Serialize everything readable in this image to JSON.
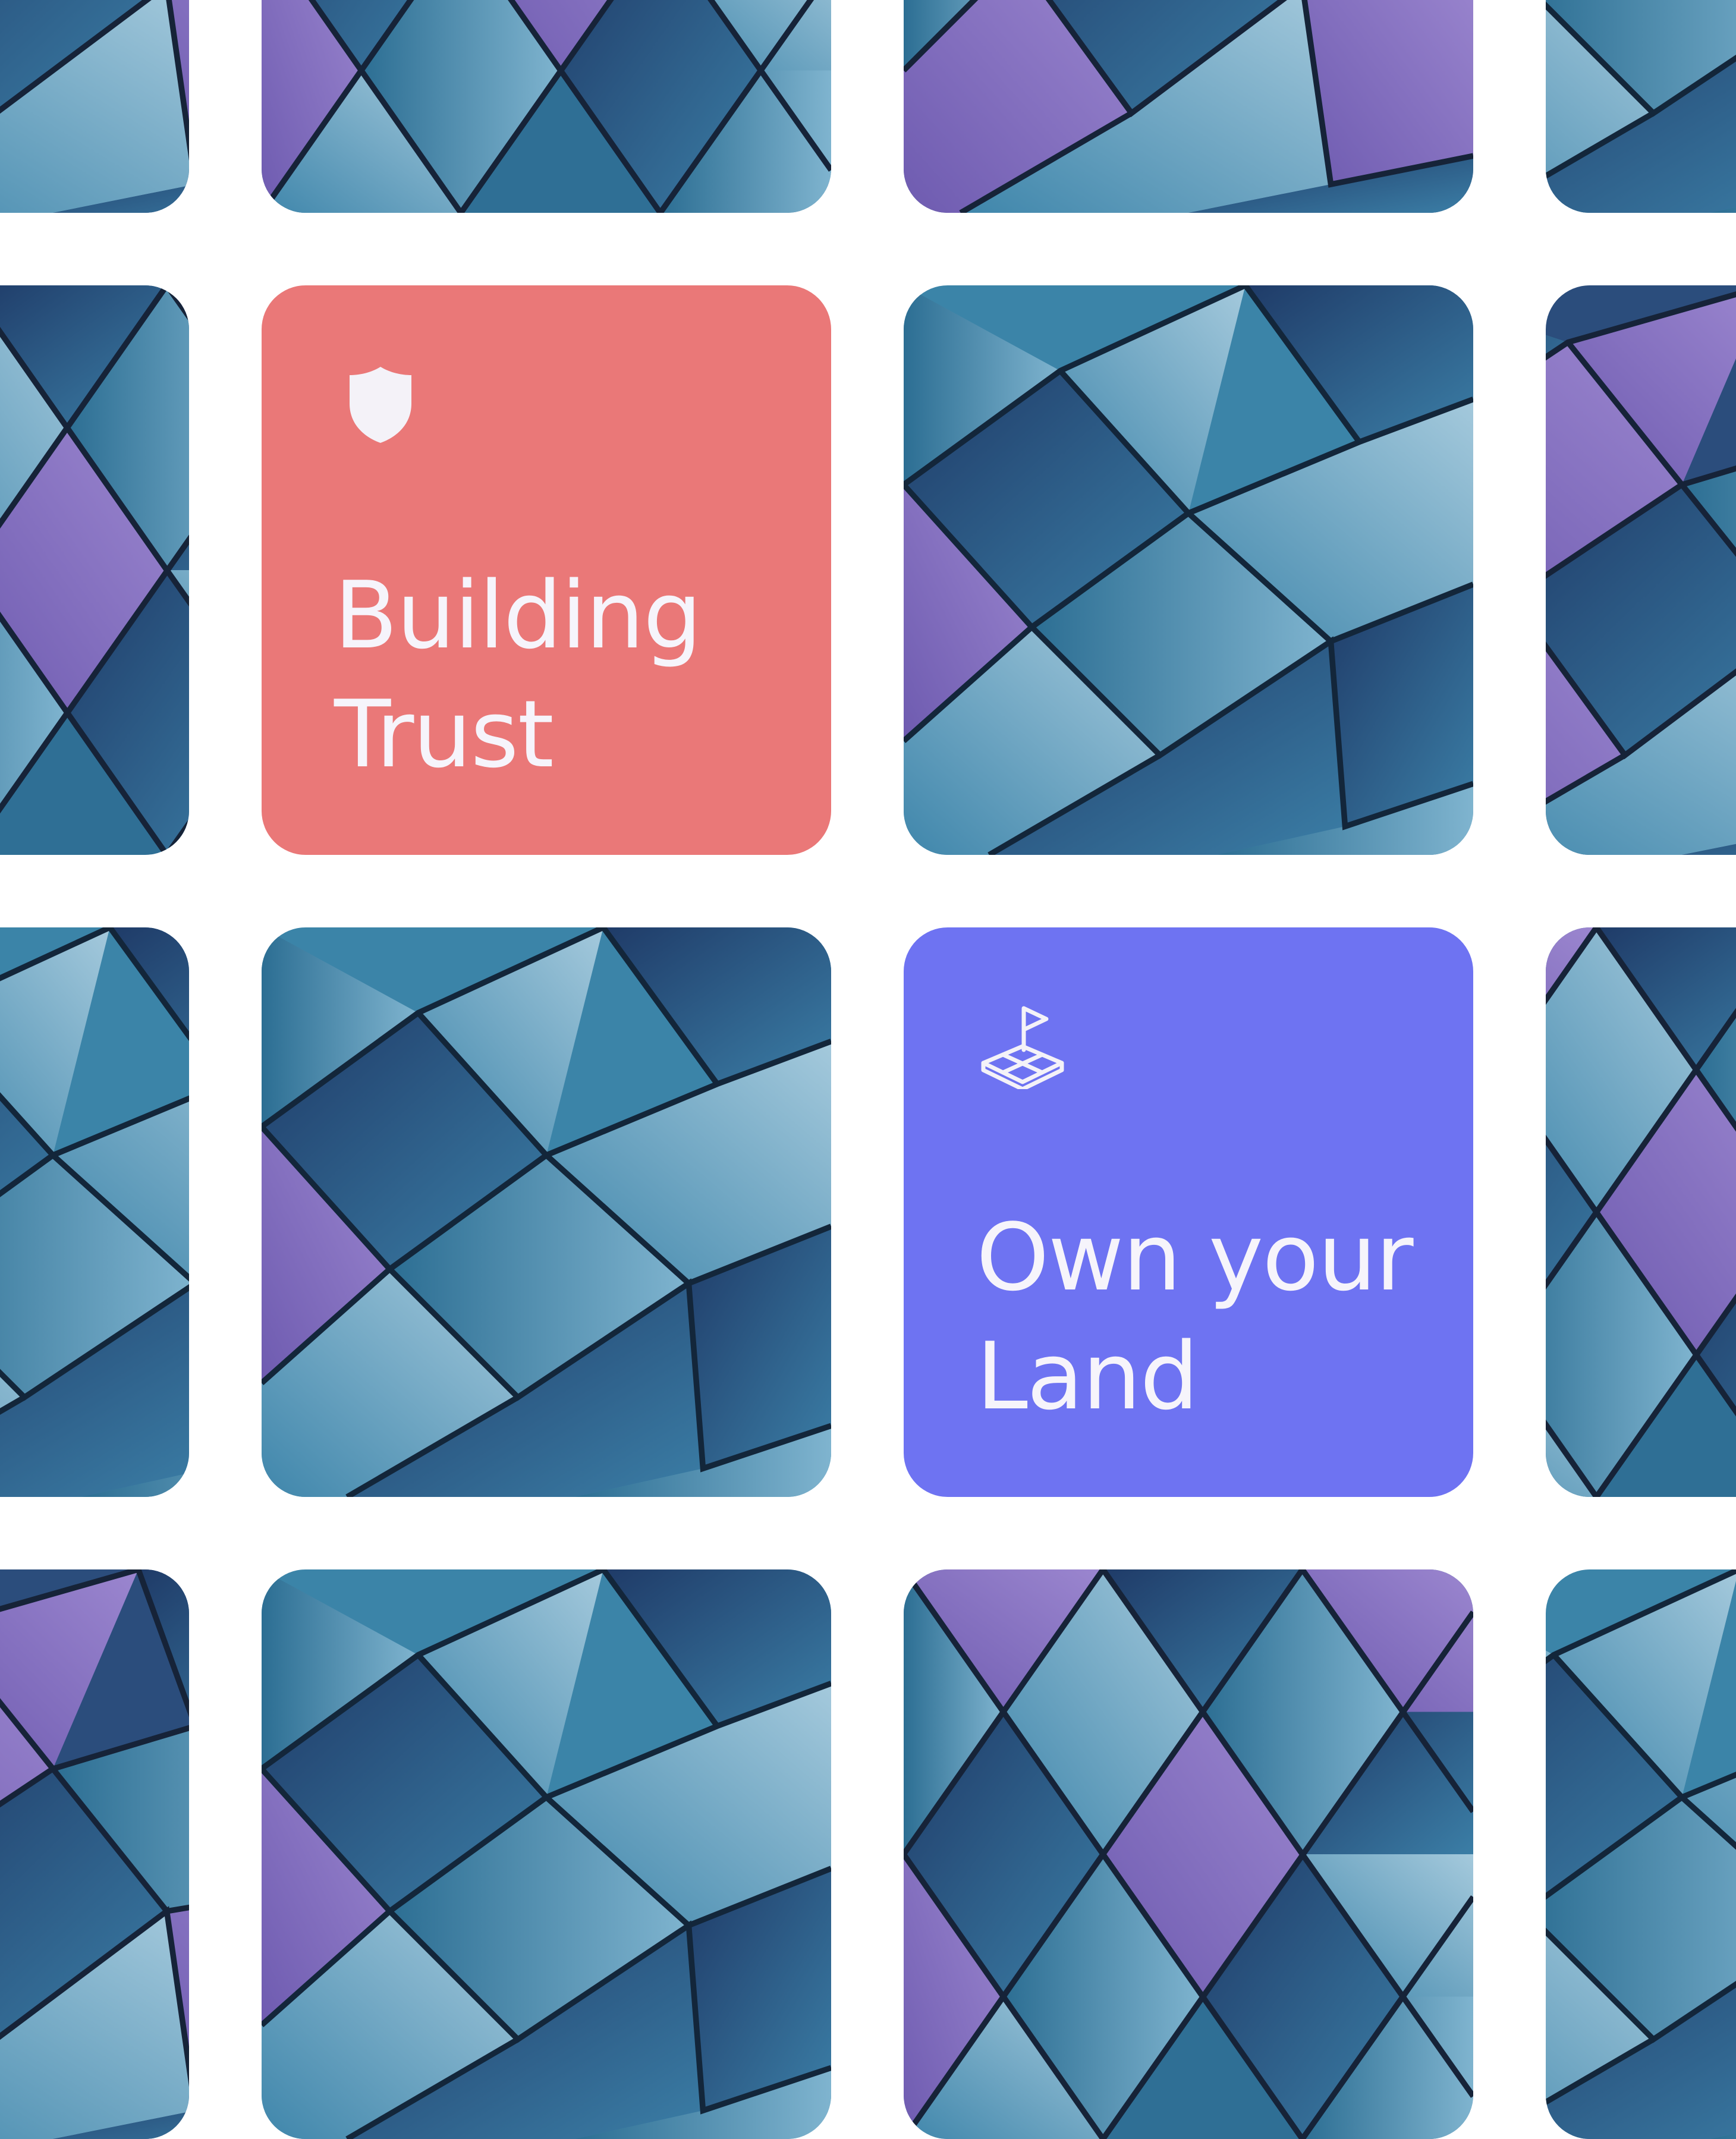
{
  "cards": {
    "building_trust": {
      "line1": "Building",
      "line2": "Trust",
      "color": "#ea7878",
      "icon": "shield-icon"
    },
    "own_your_land": {
      "line1": "Own your",
      "line2": "Land",
      "color": "#6e73f2",
      "icon": "land-flag-icon"
    }
  },
  "tiles": {
    "image": "geometric-glass-ceiling-photo",
    "palette": [
      "#1d3d63",
      "#2f6f95",
      "#5a9fc0",
      "#8a7cc7",
      "#6a5aa8",
      "#a9c7da"
    ]
  }
}
